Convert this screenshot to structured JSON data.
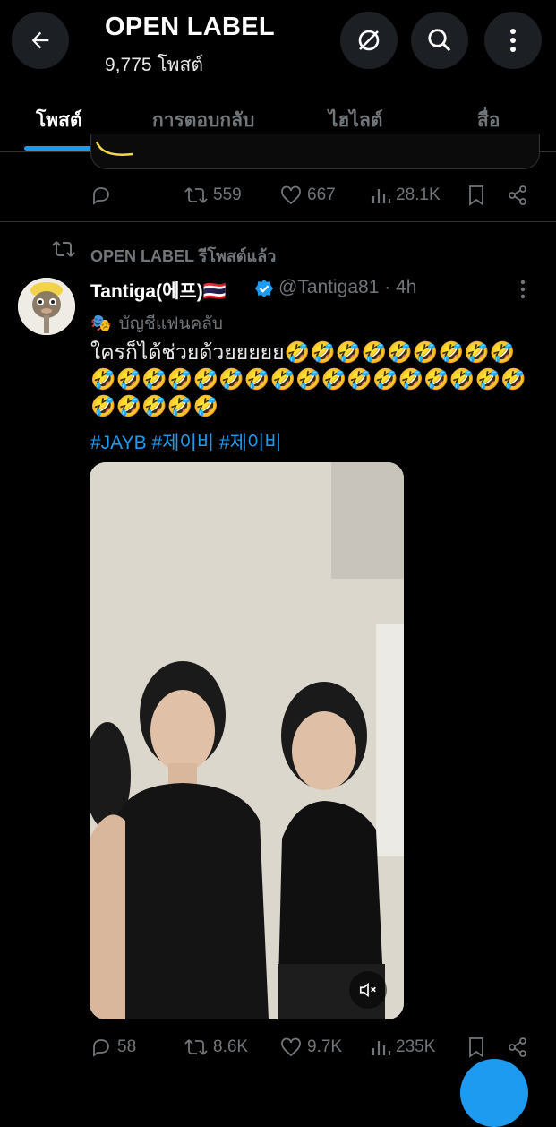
{
  "header": {
    "title": "OPEN LABEL",
    "post_count": "9,775 โพสต์"
  },
  "tabs": [
    {
      "label": "โพสต์",
      "active": true
    },
    {
      "label": "การตอบกลับ",
      "active": false
    },
    {
      "label": "ไฮไลต์",
      "active": false
    },
    {
      "label": "สื่อ",
      "active": false
    }
  ],
  "previous_tweet": {
    "retweets": "559",
    "likes": "667",
    "views": "28.1K"
  },
  "tweet": {
    "repost_label": "OPEN LABEL รีโพสต์แล้ว",
    "display_name": "Tantiga(에프)🇹🇭",
    "handle_time": "@Tantiga81 · 4h",
    "badge": "🎭",
    "fanclub_label": "บัญชีแฟนคลับ",
    "text": "ใครก็ได้ช่วยด้วยยยยย🤣🤣🤣🤣🤣🤣🤣🤣🤣🤣🤣🤣🤣🤣🤣🤣🤣🤣🤣🤣🤣🤣🤣🤣🤣🤣🤣🤣🤣🤣🤣",
    "hashtags": "#JAYB #제이비 #제이비",
    "replies": "58",
    "retweets": "8.6K",
    "likes": "9.7K",
    "views": "235K"
  },
  "colors": {
    "accent": "#1d9bf0",
    "muted": "#71767b",
    "divider": "#2f3336",
    "verified": "#1d9bf0"
  }
}
